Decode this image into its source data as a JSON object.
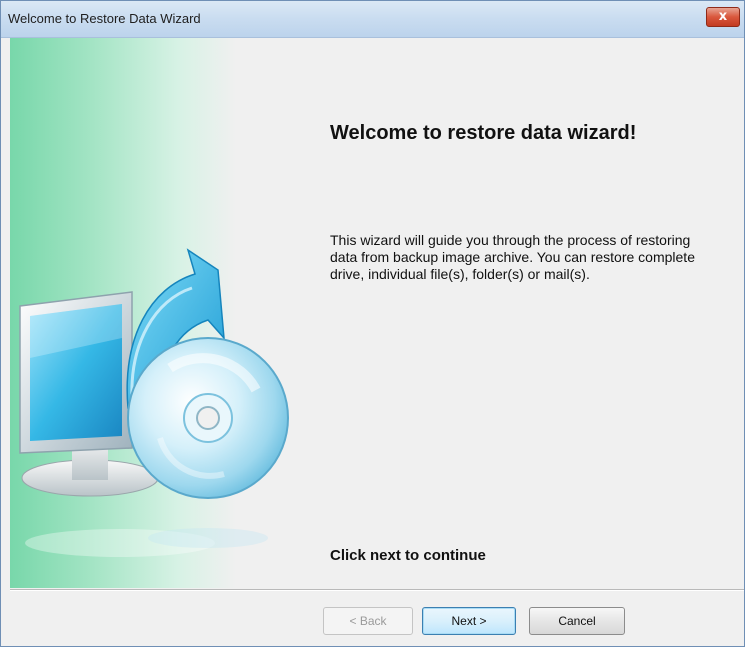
{
  "window": {
    "title": "Welcome to Restore Data Wizard",
    "close_glyph": "x"
  },
  "side_panel": {
    "image_icon": "restore-disc-monitor-icon",
    "colors": {
      "gradient_start": "#78d7aa",
      "arrow": "#29aee0",
      "monitor_screen": "#35b8e6"
    }
  },
  "content": {
    "heading": "Welcome to restore data wizard!",
    "description": "This wizard will guide you through the process of restoring data from backup image archive. You can restore complete drive, individual file(s), folder(s) or mail(s).",
    "hint": "Click next to continue"
  },
  "footer": {
    "back_label": "< Back",
    "next_label": "Next >",
    "cancel_label": "Cancel",
    "back_enabled": false
  }
}
